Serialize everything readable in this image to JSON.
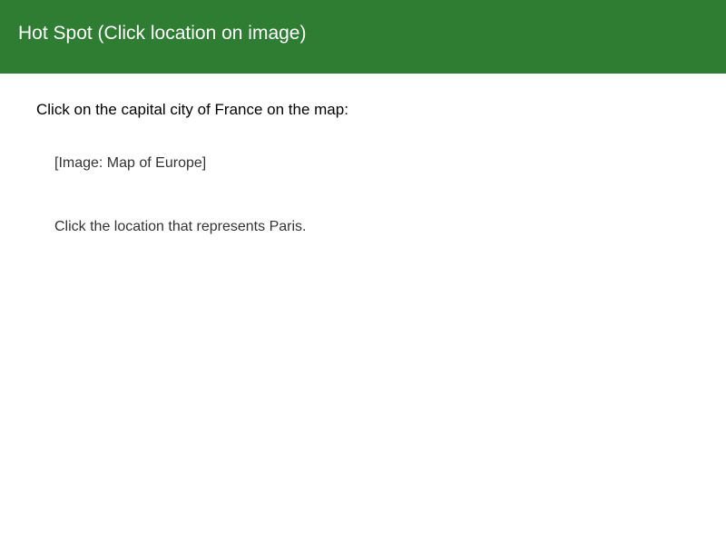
{
  "header": {
    "title": "Hot Spot (Click location on image)",
    "background_color": "#2e7d32",
    "text_color": "#ffffff"
  },
  "question": {
    "prompt": "Click on the capital city of France on the map:",
    "image_placeholder": "[Image: Map of Europe]",
    "instruction": "Click the location that represents Paris."
  }
}
